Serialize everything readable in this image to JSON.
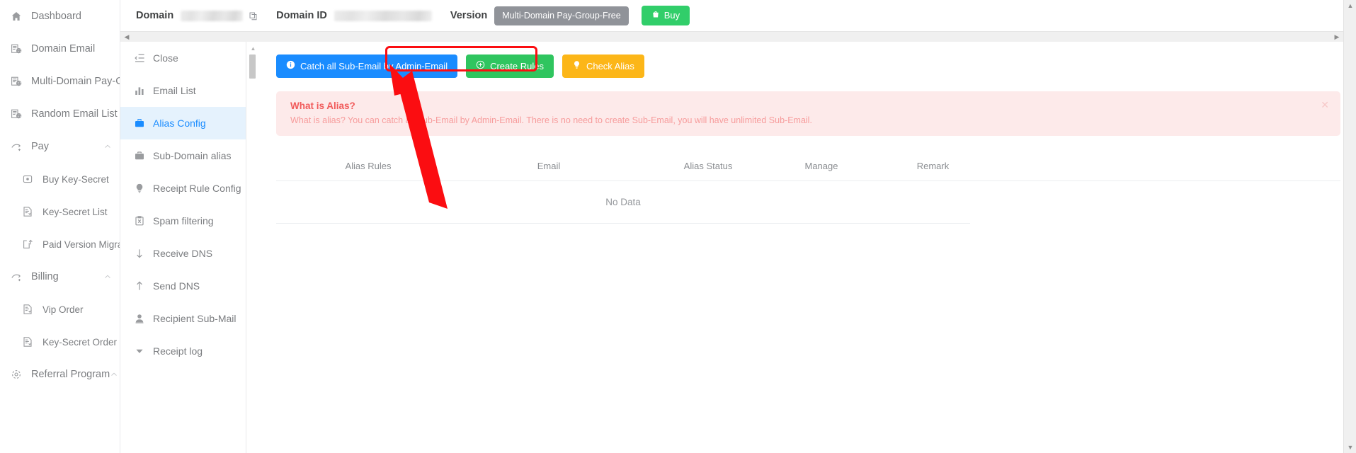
{
  "sidebar": {
    "items": [
      {
        "label": "Dashboard",
        "icon": "home-icon",
        "level": "top",
        "expandable": false
      },
      {
        "label": "Domain Email",
        "icon": "domain-email-icon",
        "level": "top",
        "expandable": false
      },
      {
        "label": "Multi-Domain Pay-Group",
        "icon": "domain-email-icon",
        "level": "top",
        "expandable": false
      },
      {
        "label": "Random Email List",
        "icon": "domain-email-icon",
        "level": "top",
        "expandable": false
      },
      {
        "label": "Pay",
        "icon": "pay-icon",
        "level": "top",
        "expandable": true
      },
      {
        "label": "Buy Key-Secret",
        "icon": "wallet-icon",
        "level": "sub",
        "expandable": false
      },
      {
        "label": "Key-Secret List",
        "icon": "list-doc-icon",
        "level": "sub",
        "expandable": false
      },
      {
        "label": "Paid Version Migration",
        "icon": "upload-box-icon",
        "level": "sub",
        "expandable": false
      },
      {
        "label": "Billing",
        "icon": "pay-icon",
        "level": "top",
        "expandable": true
      },
      {
        "label": "Vip Order",
        "icon": "list-doc-icon",
        "level": "sub",
        "expandable": false
      },
      {
        "label": "Key-Secret Order",
        "icon": "list-doc-icon",
        "level": "sub",
        "expandable": false
      },
      {
        "label": "Referral Program",
        "icon": "referral-icon",
        "level": "top",
        "expandable": true
      }
    ]
  },
  "topbar": {
    "domain_label": "Domain",
    "domain_value": "",
    "domain_id_label": "Domain ID",
    "domain_id_value": "",
    "version_label": "Version",
    "version_badge": "Multi-Domain Pay-Group-Free",
    "buy_button": "Buy",
    "copy_icon": "copy-icon",
    "buy_icon": "shopping-bag-icon"
  },
  "submenu": {
    "items": [
      {
        "label": "Close",
        "icon": "close-panel-icon",
        "active": false
      },
      {
        "label": "Email List",
        "icon": "bar-chart-icon",
        "active": false
      },
      {
        "label": "Alias Config",
        "icon": "briefcase-icon",
        "active": true
      },
      {
        "label": "Sub-Domain alias",
        "icon": "briefcase-icon",
        "active": false
      },
      {
        "label": "Receipt Rule Config",
        "icon": "bulb-icon",
        "active": false
      },
      {
        "label": "Spam filtering",
        "icon": "spam-clipboard-icon",
        "active": false
      },
      {
        "label": "Receive DNS",
        "icon": "arrow-down-icon",
        "active": false
      },
      {
        "label": "Send DNS",
        "icon": "arrow-up-icon",
        "active": false
      },
      {
        "label": "Recipient Sub-Mail",
        "icon": "user-icon",
        "active": false
      },
      {
        "label": "Receipt log",
        "icon": "caret-down-icon",
        "active": false
      }
    ]
  },
  "toolbar": {
    "catch_all_label": "Catch all Sub-Email by Admin-Email",
    "catch_all_icon": "info-circle-icon",
    "create_rules_label": "Create Rules",
    "create_rules_icon": "plus-circle-icon",
    "check_alias_label": "Check Alias",
    "check_alias_icon": "bulb-icon"
  },
  "alert": {
    "title": "What is Alias?",
    "text": "What is alias? You can catch all Sub-Email by Admin-Email. There is no need to create Sub-Email, you will have unlimited Sub-Email.",
    "close_icon": "close-icon"
  },
  "table": {
    "columns": [
      "Alias Rules",
      "Email",
      "Alias Status",
      "Manage",
      "Remark"
    ],
    "rows": [],
    "empty_text": "No Data"
  },
  "annotation": {
    "highlight_target": "catch-all-sub-email-button",
    "arrow_color": "#fb0d11"
  },
  "colors": {
    "accent_blue": "#1a8cff",
    "green": "#2fc55f",
    "amber": "#fcb618",
    "buy_green": "#31ce6a",
    "badge_gray": "#909399",
    "alert_bg": "#fdeaea",
    "alert_title": "#f15b5b",
    "alert_text": "#f79c9c",
    "active_bg": "#e5f2fd"
  }
}
